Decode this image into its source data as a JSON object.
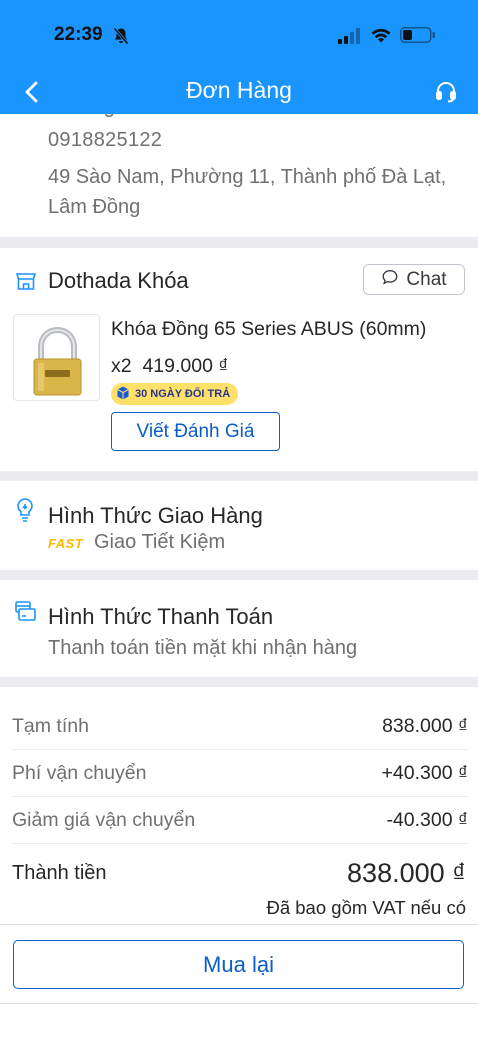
{
  "status_bar": {
    "time": "22:39"
  },
  "header": {
    "title": "Đơn Hàng"
  },
  "address": {
    "name": "Trương Đức Phú",
    "phone": "0918825122",
    "line": "49 Sào Nam, Phường 11, Thành phố Đà Lạt, Lâm Đồng"
  },
  "shop": {
    "name": "Dothada Khóa",
    "chat_label": "Chat",
    "product": {
      "name": "Khóa Đồng 65 Series ABUS (60mm)",
      "quantity": "x2",
      "price": "419.000 ₫",
      "return_badge": "30 NGÀY ĐỔI TRẢ",
      "review_label": "Viết Đánh Giá"
    }
  },
  "delivery": {
    "title": "Hình Thức Giao Hàng",
    "tag": "FAST",
    "type": "Giao Tiết Kiệm"
  },
  "payment": {
    "title": "Hình Thức Thanh Toán",
    "desc": "Thanh toán tiền mặt khi nhận hàng"
  },
  "summary": {
    "rows": [
      {
        "label": "Tạm tính",
        "value": "838.000 ₫"
      },
      {
        "label": "Phí vận chuyển",
        "value": "+40.300 ₫"
      },
      {
        "label": "Giảm giá vận chuyển",
        "value": "-40.300 ₫"
      }
    ],
    "total_label": "Thành tiền",
    "total_value": "838.000 ₫",
    "vat_note": "Đã bao gồm VAT nếu có"
  },
  "rebuy_label": "Mua lại",
  "colors": {
    "brand_blue": "#1a94ff",
    "link_blue": "#0b5ec7",
    "badge_yellow": "#ffe16a",
    "fast_yellow": "#ffb800"
  }
}
